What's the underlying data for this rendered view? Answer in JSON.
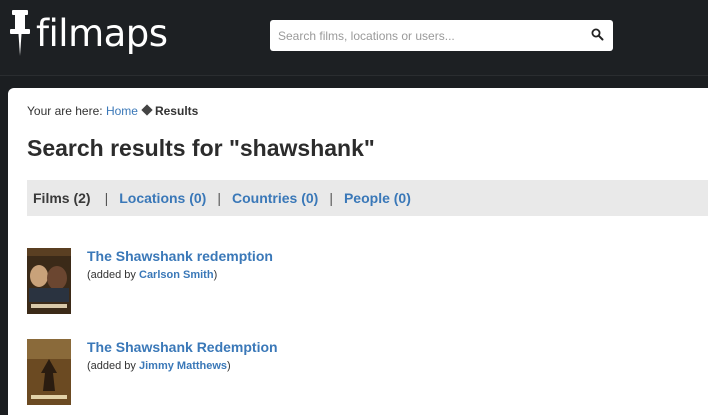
{
  "header": {
    "logo_text": "filmaps",
    "logo_icon": "pushpin-icon",
    "search": {
      "placeholder": "Search films, locations or users...",
      "value": "",
      "icon": "search-icon"
    }
  },
  "breadcrumb": {
    "prefix": "Your are here:",
    "home": "Home",
    "current": "Results"
  },
  "page_title": "Search results for \"shawshank\"",
  "tabs": [
    {
      "label": "Films (2)",
      "active": true
    },
    {
      "label": "Locations (0)",
      "active": false
    },
    {
      "label": "Countries (0)",
      "active": false
    },
    {
      "label": "People (0)",
      "active": false
    }
  ],
  "tab_separator": "|",
  "results": [
    {
      "title": "The Shawshank redemption",
      "added_prefix": "(added by",
      "user": "Carlson Smith",
      "added_suffix": ")",
      "poster": "film-poster-image"
    },
    {
      "title": "The Shawshank Redemption",
      "added_prefix": "(added by",
      "user": "Jimmy Matthews",
      "added_suffix": ")",
      "poster": "film-poster-image"
    }
  ]
}
